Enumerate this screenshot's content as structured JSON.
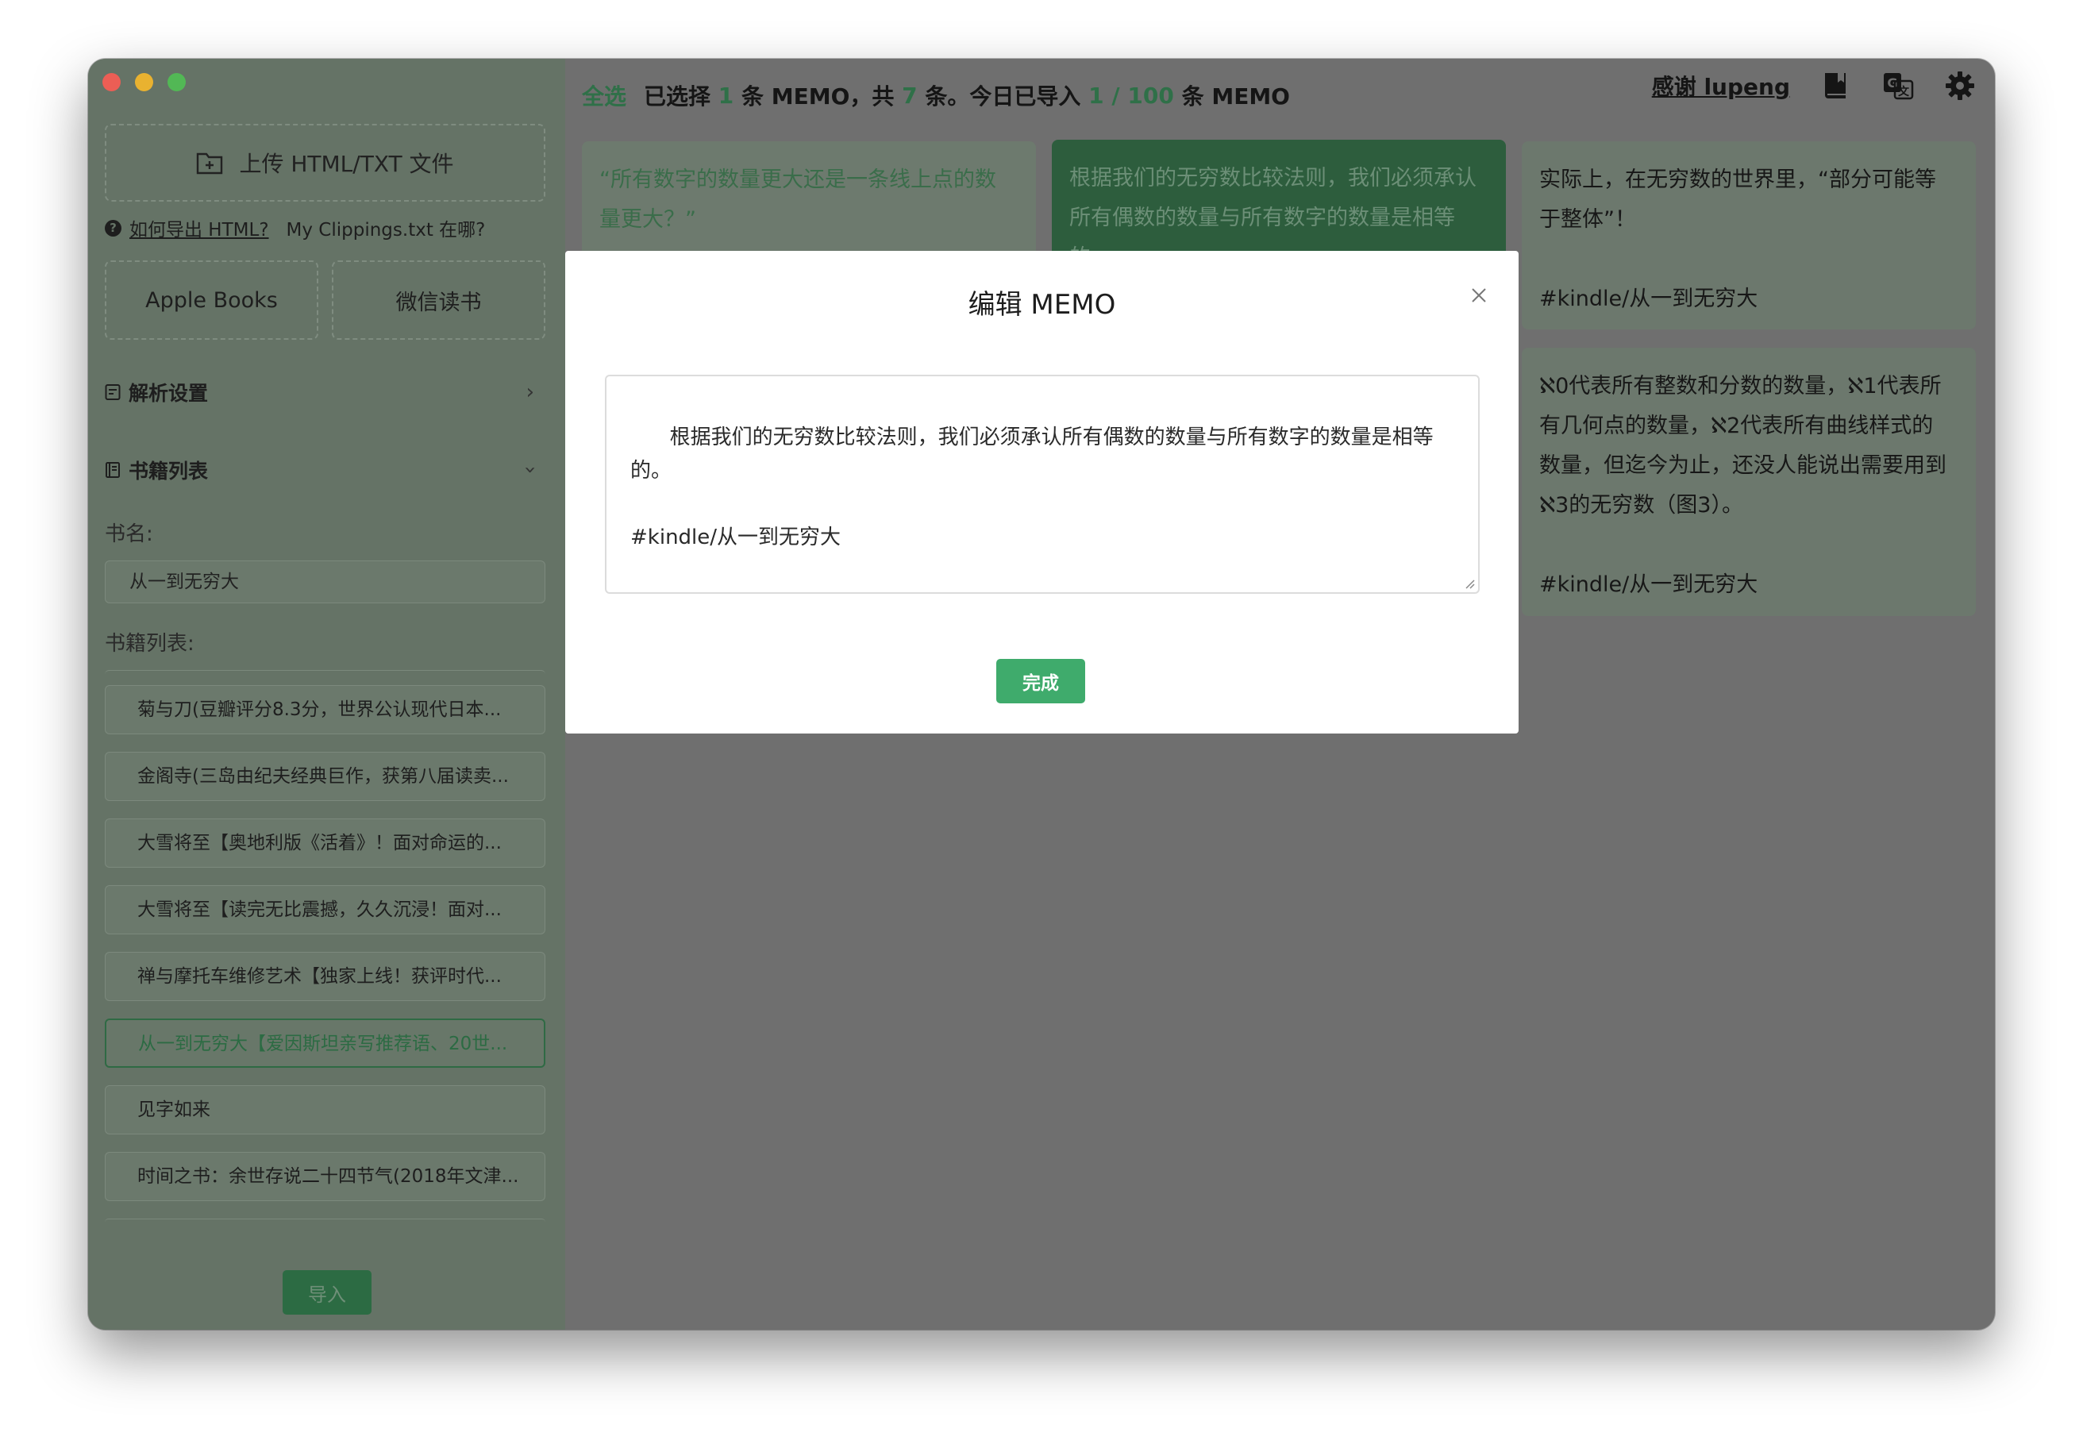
{
  "sidebar": {
    "upload_label": "上传 HTML/TXT 文件",
    "help_link": "如何导出 HTML?",
    "help_text": "My Clippings.txt 在哪?",
    "sources": [
      "Apple Books",
      "微信读书"
    ],
    "parse_settings": "解析设置",
    "book_list_section": "书籍列表",
    "book_name_label": "书名:",
    "book_name_value": "从一到无穷大",
    "book_list_label": "书籍列表:",
    "books": [
      "菊与刀(豆瓣评分8.3分，世界公认现代日本...",
      "金阁寺(三岛由纪夫经典巨作，获第八届读卖...",
      "大雪将至【奥地利版《活着》！面对命运的...",
      "大雪将至【读完无比震撼，久久沉浸！面对...",
      "禅与摩托车维修艺术【独家上线！获评时代...",
      "从一到无穷大【爱因斯坦亲写推荐语、20世...",
      "见字如来",
      "时间之书：余世存说二十四节气(2018年文津..."
    ],
    "active_book_index": 5,
    "import_label": "导入"
  },
  "topbar": {
    "select_all": "全选",
    "t1": "已选择",
    "selected": "1",
    "t2": "条 MEMO，共",
    "total": "7",
    "t3": "条。今日已导入",
    "imported": "1 / 100",
    "t4": "条 MEMO",
    "thanks": "感谢 lupeng"
  },
  "memos": {
    "a": "“所有数字的数量更大还是一条线上点的数\n量更大？”",
    "b": "根据我们的无穷数比较法则，我们必须承认\n所有偶数的数量与所有数字的数量是相等\n的。",
    "c": "实际上，在无穷数的世界里，“部分可能等\n于整体”！\n\n#kindle/从一到无穷大",
    "d": "ℵ0代表所有整数和分数的数量，ℵ1代表所\n有几何点的数量，ℵ2代表所有曲线样式的\n数量，但迄今为止，还没人能说出需要用到\nℵ3的无穷数（图3）。\n\n#kindle/从一到无穷大"
  },
  "modal": {
    "title": "编辑 MEMO",
    "content": "根据我们的无穷数比较法则，我们必须承认所有偶数的数量与所有数字的数量是相等\n的。\n\n#kindle/从一到无穷大",
    "done_label": "完成"
  },
  "colors": {
    "accent_green": "#3fab6c",
    "dark_green": "#2c6b43",
    "overlay": "#6f6f6f"
  }
}
